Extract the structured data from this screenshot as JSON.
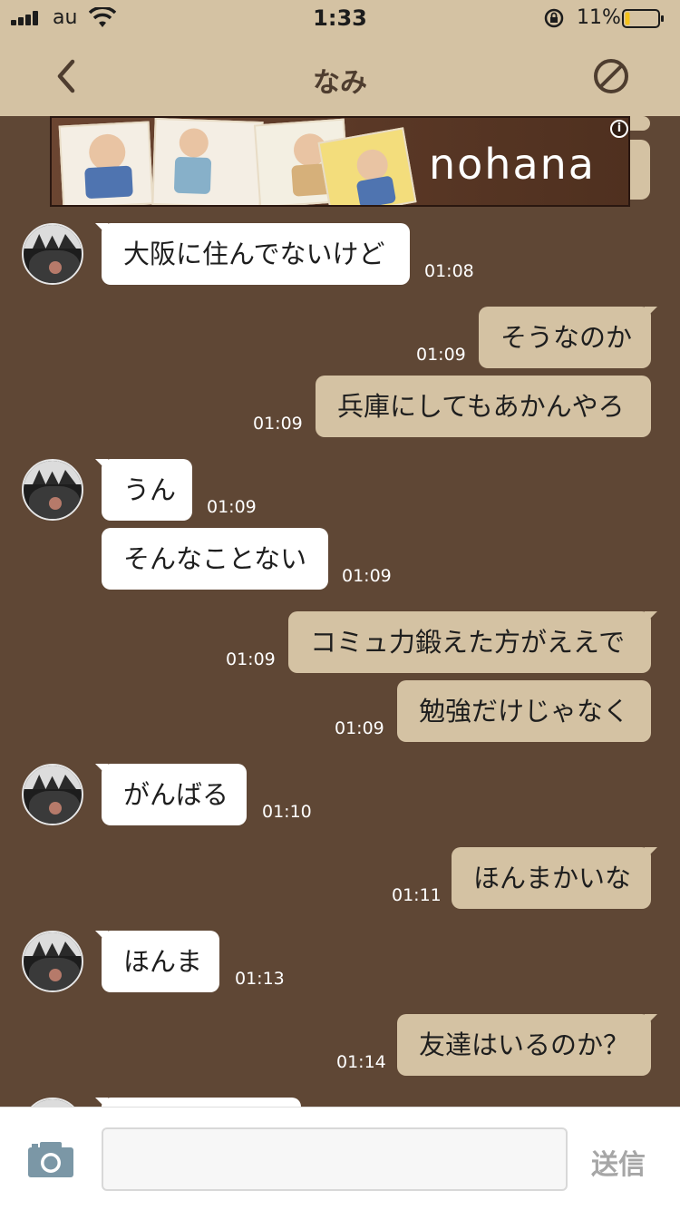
{
  "status_bar": {
    "carrier": "au",
    "time": "1:33",
    "battery": "11%",
    "battery_level": 0.11
  },
  "header": {
    "title": "なみ",
    "back_icon": "chevron-left-icon",
    "block_icon": "block-icon"
  },
  "ad": {
    "brand": "nohana",
    "info_label": "i"
  },
  "messages": [
    {
      "side": "in",
      "text": "大阪に住んでないけど",
      "time": "01:08"
    },
    {
      "side": "out",
      "text": "そうなのか",
      "time": "01:09"
    },
    {
      "side": "out",
      "text": "兵庫にしてもあかんやろ",
      "time": "01:09"
    },
    {
      "side": "in",
      "text": "うん",
      "time": "01:09"
    },
    {
      "side": "in",
      "text": "そんなことない",
      "time": "01:09"
    },
    {
      "side": "out",
      "text": "コミュ力鍛えた方がええで",
      "time": "01:09"
    },
    {
      "side": "out",
      "text": "勉強だけじゃなく",
      "time": "01:09"
    },
    {
      "side": "in",
      "text": "がんばる",
      "time": "01:10"
    },
    {
      "side": "out",
      "text": "ほんまかいな",
      "time": "01:11"
    },
    {
      "side": "in",
      "text": "ほんま",
      "time": "01:13"
    },
    {
      "side": "out",
      "text": "友達はいるのか？",
      "time": "01:14"
    }
  ],
  "input": {
    "placeholder": "",
    "send_label": "送信",
    "camera_icon": "camera-icon"
  },
  "colors": {
    "bar": "#d4c2a3",
    "background": "#5f4735",
    "incoming_bubble": "#ffffff",
    "outgoing_bubble": "#d4c2a3"
  }
}
